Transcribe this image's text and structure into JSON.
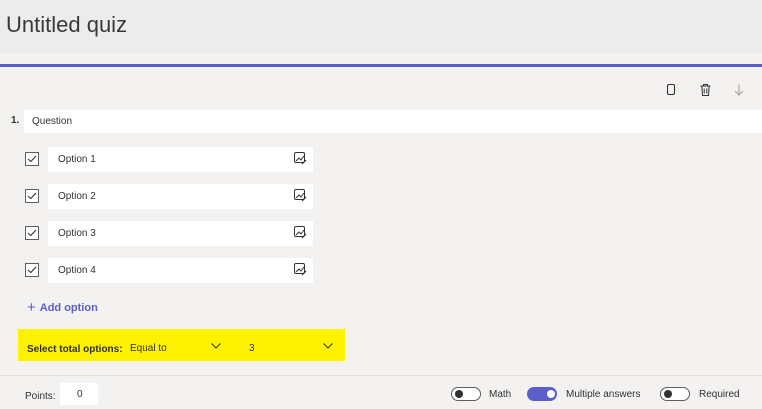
{
  "colors": {
    "accent": "#5b5fc7",
    "highlight": "#fff200",
    "title_bar": "#ececec"
  },
  "quiz": {
    "title": "Untitled quiz"
  },
  "toolbar": {
    "copy_icon": "copy-icon",
    "delete_icon": "trash-icon",
    "move_down_icon": "arrow-down-icon"
  },
  "question": {
    "number": "1.",
    "placeholder": "Question",
    "options": [
      {
        "label": "Option 1",
        "checked": true
      },
      {
        "label": "Option 2",
        "checked": true
      },
      {
        "label": "Option 3",
        "checked": true
      },
      {
        "label": "Option 4",
        "checked": true
      }
    ],
    "add_option_label": "Add option"
  },
  "select_total": {
    "label": "Select total options:",
    "comparator": "Equal to",
    "count": "3"
  },
  "footer": {
    "points_label": "Points:",
    "points_value": "0",
    "math_label": "Math",
    "math_on": false,
    "multiple_label": "Multiple answers",
    "multiple_on": true,
    "required_label": "Required",
    "required_on": false
  }
}
